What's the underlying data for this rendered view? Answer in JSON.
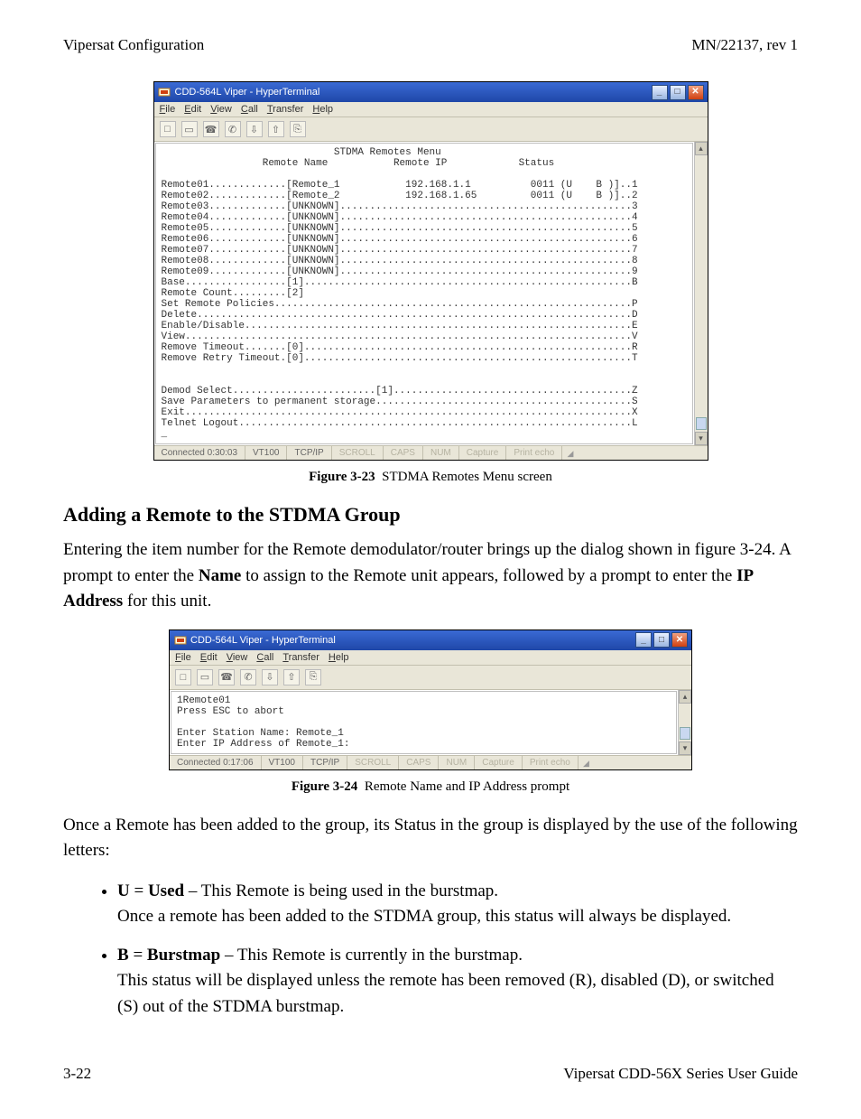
{
  "header": {
    "left": "Vipersat Configuration",
    "right": "MN/22137, rev 1"
  },
  "figure1": {
    "window_title": "CDD-564L Viper - HyperTerminal",
    "menu": [
      "File",
      "Edit",
      "View",
      "Call",
      "Transfer",
      "Help"
    ],
    "terminal": "                             STDMA Remotes Menu\n                 Remote Name           Remote IP            Status\n\nRemote01.............[Remote_1           192.168.1.1          0011 (U    B )]..1\nRemote02.............[Remote_2           192.168.1.65         0011 (U    B )]..2\nRemote03.............[UNKNOWN].................................................3\nRemote04.............[UNKNOWN].................................................4\nRemote05.............[UNKNOWN].................................................5\nRemote06.............[UNKNOWN].................................................6\nRemote07.............[UNKNOWN].................................................7\nRemote08.............[UNKNOWN].................................................8\nRemote09.............[UNKNOWN].................................................9\nBase.................[1].......................................................B\nRemote Count.........[2]\nSet Remote Policies............................................................P\nDelete.........................................................................D\nEnable/Disable.................................................................E\nView...........................................................................V\nRemove Timeout.......[0].......................................................R\nRemove Retry Timeout.[0].......................................................T\n\n\nDemod Select........................[1]........................................Z\nSave Parameters to permanent storage...........................................S\nExit...........................................................................X\nTelnet Logout..................................................................L\n_",
    "status": {
      "connected": "Connected 0:30:03",
      "term": "VT100",
      "proto": "TCP/IP",
      "scroll": "SCROLL",
      "caps": "CAPS",
      "num": "NUM",
      "capture": "Capture",
      "printecho": "Print echo"
    },
    "caption_label": "Figure 3-23",
    "caption_text": "STDMA Remotes Menu screen"
  },
  "section_title": "Adding a Remote to the STDMA Group",
  "para1_pre": "Entering the item number for the Remote demodulator/router brings up the dialog shown in figure 3-24. A prompt to enter the ",
  "para1_bold1": "Name",
  "para1_mid": " to assign to the Remote unit appears, followed by a prompt to enter the ",
  "para1_bold2": "IP Address",
  "para1_post": " for this unit.",
  "figure2": {
    "window_title": "CDD-564L Viper - HyperTerminal",
    "menu": [
      "File",
      "Edit",
      "View",
      "Call",
      "Transfer",
      "Help"
    ],
    "terminal": "1Remote01\nPress ESC to abort\n\nEnter Station Name: Remote_1\nEnter IP Address of Remote_1:",
    "status": {
      "connected": "Connected 0:17:06",
      "term": "VT100",
      "proto": "TCP/IP",
      "scroll": "SCROLL",
      "caps": "CAPS",
      "num": "NUM",
      "capture": "Capture",
      "printecho": "Print echo"
    },
    "caption_label": "Figure 3-24",
    "caption_text": "Remote Name and IP Address prompt"
  },
  "para2": "Once a Remote has been added to the group, its Status in the group is displayed by the use of the following letters:",
  "bullets": {
    "item1_a": "U",
    "item1_b": " = ",
    "item1_c": "Used",
    "item1_d": " – This Remote is being used in the burstmap.",
    "item1_e": "Once a remote has been added to the STDMA group, this status will always be displayed.",
    "item2_a": "B",
    "item2_b": " = ",
    "item2_c": "Burstmap",
    "item2_d": " – This Remote is currently in the burstmap.",
    "item2_e": "This status will be displayed unless the remote has been removed (R), disabled (D), or switched (S) out of the STDMA burstmap."
  },
  "footer": {
    "left": "3-22",
    "right": "Vipersat CDD-56X Series User Guide"
  }
}
